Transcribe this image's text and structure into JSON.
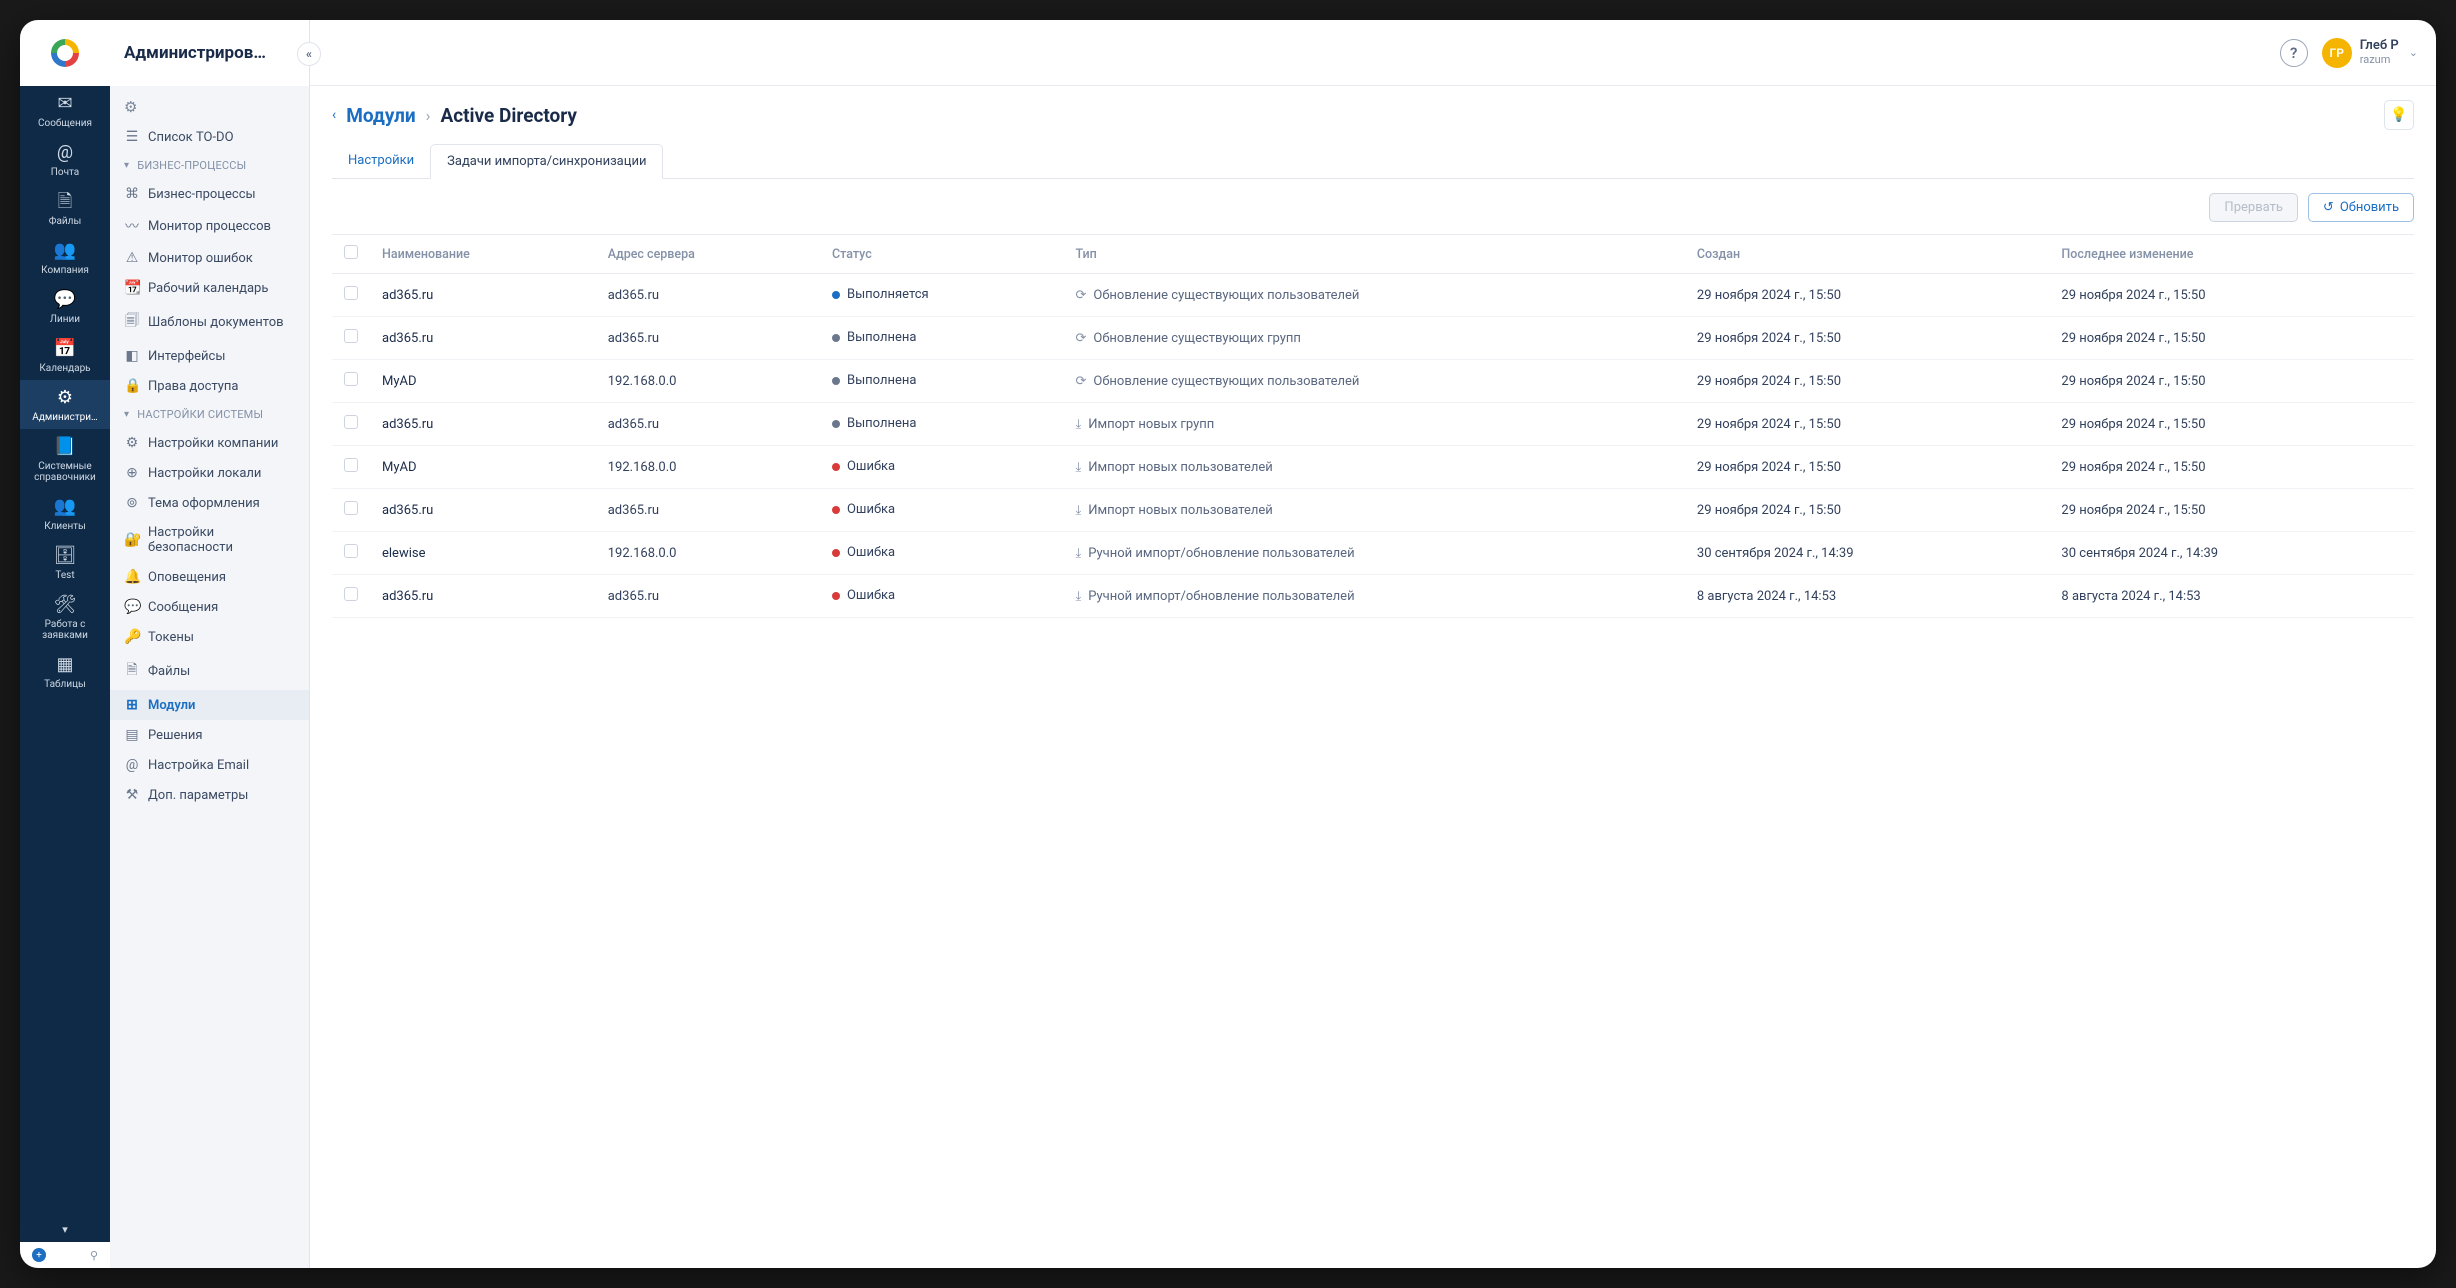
{
  "rail": {
    "items": [
      {
        "icon": "✉",
        "label": "Сообщения"
      },
      {
        "icon": "@",
        "label": "Почта"
      },
      {
        "icon": "🗎",
        "label": "Файлы"
      },
      {
        "icon": "👥",
        "label": "Компания"
      },
      {
        "icon": "💬",
        "label": "Линии"
      },
      {
        "icon": "📅",
        "label": "Календарь"
      },
      {
        "icon": "⚙",
        "label": "Администри…",
        "active": true
      },
      {
        "icon": "📘",
        "label": "Системные справочники"
      },
      {
        "icon": "👥",
        "label": "Клиенты"
      },
      {
        "icon": "🗄",
        "label": "Test"
      },
      {
        "icon": "🛠",
        "label": "Работа с заявками"
      },
      {
        "icon": "▦",
        "label": "Таблицы"
      }
    ]
  },
  "tree": {
    "title": "Администриров…",
    "todo": "Список TO-DO",
    "section_bp": "БИЗНЕС-ПРОЦЕССЫ",
    "bp": [
      {
        "icon": "⌘",
        "label": "Бизнес-процессы"
      },
      {
        "icon": "〰",
        "label": "Монитор процессов"
      },
      {
        "icon": "⚠",
        "label": "Монитор ошибок"
      },
      {
        "icon": "📆",
        "label": "Рабочий календарь"
      },
      {
        "icon": "🗐",
        "label": "Шаблоны документов"
      },
      {
        "icon": "◧",
        "label": "Интерфейсы"
      },
      {
        "icon": "🔒",
        "label": "Права доступа"
      }
    ],
    "section_sys": "НАСТРОЙКИ СИСТЕМЫ",
    "sys": [
      {
        "icon": "⚙",
        "label": "Настройки компании"
      },
      {
        "icon": "⊕",
        "label": "Настройки локали"
      },
      {
        "icon": "⊚",
        "label": "Тема оформления"
      },
      {
        "icon": "🔐",
        "label": "Настройки безопасности"
      },
      {
        "icon": "🔔",
        "label": "Оповещения"
      },
      {
        "icon": "💬",
        "label": "Сообщения"
      },
      {
        "icon": "🔑",
        "label": "Токены"
      },
      {
        "icon": "🗎",
        "label": "Файлы"
      },
      {
        "icon": "⊞",
        "label": "Модули",
        "active": true
      },
      {
        "icon": "▤",
        "label": "Решения"
      },
      {
        "icon": "@",
        "label": "Настройка Email"
      },
      {
        "icon": "⚒",
        "label": "Доп. параметры"
      }
    ]
  },
  "header": {
    "user_name": "Глеб Р",
    "user_sub": "razum",
    "avatar_initials": "ГР"
  },
  "breadcrumb": {
    "modules": "Модули",
    "current": "Active Directory"
  },
  "tabs": {
    "settings": "Настройки",
    "tasks": "Задачи импорта/синхронизации"
  },
  "toolbar": {
    "abort": "Прервать",
    "refresh": "Обновить"
  },
  "columns": {
    "name": "Наименование",
    "server": "Адрес сервера",
    "status": "Статус",
    "type": "Тип",
    "created": "Создан",
    "modified": "Последнее изменение"
  },
  "statuses": {
    "running": "Выполняется",
    "done": "Выполнена",
    "error": "Ошибка"
  },
  "types": {
    "upd_users": "Обновление существующих пользователей",
    "upd_groups": "Обновление существующих групп",
    "imp_groups": "Импорт новых групп",
    "imp_users": "Импорт новых пользователей",
    "manual_users": "Ручной импорт/обновление пользователей"
  },
  "type_icons": {
    "sync": "⟳",
    "import": "⤓"
  },
  "rows": [
    {
      "name": "ad365.ru",
      "server": "ad365.ru",
      "status": "running",
      "type": "upd_users",
      "ticon": "sync",
      "created": "29 ноября 2024 г., 15:50",
      "modified": "29 ноября 2024 г., 15:50"
    },
    {
      "name": "ad365.ru",
      "server": "ad365.ru",
      "status": "done",
      "type": "upd_groups",
      "ticon": "sync",
      "created": "29 ноября 2024 г., 15:50",
      "modified": "29 ноября 2024 г., 15:50"
    },
    {
      "name": "MyAD",
      "server": "192.168.0.0",
      "status": "done",
      "type": "upd_users",
      "ticon": "sync",
      "created": "29 ноября 2024 г., 15:50",
      "modified": "29 ноября 2024 г., 15:50"
    },
    {
      "name": "ad365.ru",
      "server": "ad365.ru",
      "status": "done",
      "type": "imp_groups",
      "ticon": "import",
      "created": "29 ноября 2024 г., 15:50",
      "modified": "29 ноября 2024 г., 15:50"
    },
    {
      "name": "MyAD",
      "server": "192.168.0.0",
      "status": "error",
      "type": "imp_users",
      "ticon": "import",
      "created": "29 ноября 2024 г., 15:50",
      "modified": "29 ноября 2024 г., 15:50"
    },
    {
      "name": "ad365.ru",
      "server": "ad365.ru",
      "status": "error",
      "type": "imp_users",
      "ticon": "import",
      "created": "29 ноября 2024 г., 15:50",
      "modified": "29 ноября 2024 г., 15:50"
    },
    {
      "name": "elewise",
      "server": "192.168.0.0",
      "status": "error",
      "type": "manual_users",
      "ticon": "import",
      "created": "30 сентября 2024 г., 14:39",
      "modified": "30 сентября 2024 г., 14:39"
    },
    {
      "name": "ad365.ru",
      "server": "ad365.ru",
      "status": "error",
      "type": "manual_users",
      "ticon": "import",
      "created": "8 августа 2024 г., 14:53",
      "modified": "8 августа 2024 г., 14:53"
    }
  ]
}
